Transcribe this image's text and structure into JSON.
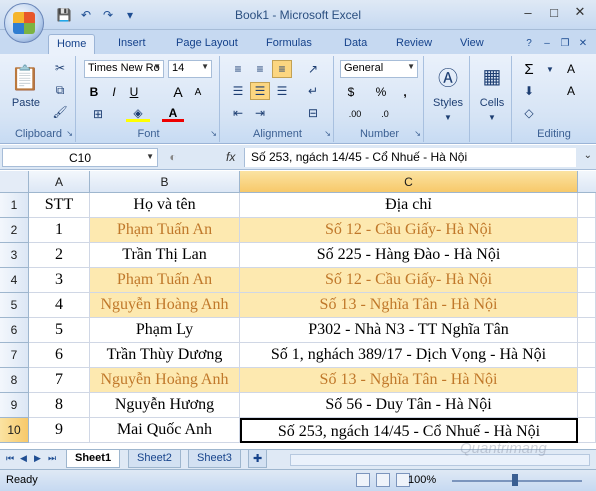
{
  "window": {
    "title": "Book1 - Microsoft Excel",
    "minimize": "–",
    "restore": "□",
    "close": "✕"
  },
  "qat": {
    "save": "💾",
    "undo": "↶",
    "redo": "↷",
    "customize": "▾"
  },
  "tabs": [
    "Home",
    "Insert",
    "Page Layout",
    "Formulas",
    "Data",
    "Review",
    "View"
  ],
  "ribbon": {
    "clipboard": {
      "label": "Clipboard",
      "paste": "Paste"
    },
    "font": {
      "label": "Font",
      "font_name": "Times New Ro",
      "font_size": "14",
      "bold": "B",
      "italic": "I",
      "underline": "U",
      "grow": "A",
      "shrink": "A"
    },
    "alignment": {
      "label": "Alignment"
    },
    "number": {
      "label": "Number",
      "format": "General",
      "currency": "$",
      "percent": "%",
      "comma": ",",
      "inc_dec": ".00",
      "dec_dec": ".0"
    },
    "styles": {
      "label": "Styles"
    },
    "cells": {
      "label": "Cells"
    },
    "editing": {
      "label": "Editing",
      "sum": "Σ",
      "sort": "A",
      "find": "A"
    }
  },
  "formula_bar": {
    "name_box": "C10",
    "fx": "fx",
    "content": "Số 253, ngách 14/45 - Cổ Nhuế - Hà Nội"
  },
  "columns": [
    "A",
    "B",
    "C"
  ],
  "rows": [
    {
      "num": "1",
      "a": "STT",
      "b": "Họ và tên",
      "c": "Địa chỉ",
      "hl": false
    },
    {
      "num": "2",
      "a": "1",
      "b": "Phạm Tuấn An",
      "c": "Số 12 - Cầu Giấy- Hà Nội",
      "hl": true
    },
    {
      "num": "3",
      "a": "2",
      "b": "Trần Thị Lan",
      "c": "Số 225 - Hàng Đào - Hà Nội",
      "hl": false
    },
    {
      "num": "4",
      "a": "3",
      "b": "Phạm Tuấn An",
      "c": "Số 12 - Cầu Giấy- Hà Nội",
      "hl": true
    },
    {
      "num": "5",
      "a": "4",
      "b": "Nguyễn Hoàng Anh",
      "c": "Số 13 - Nghĩa Tân - Hà Nội",
      "hl": true
    },
    {
      "num": "6",
      "a": "5",
      "b": "Phạm Ly",
      "c": "P302 - Nhà N3 - TT Nghĩa Tân",
      "hl": false
    },
    {
      "num": "7",
      "a": "6",
      "b": "Trần Thùy Dương",
      "c": "Số 1, nghách 389/17 - Dịch Vọng - Hà Nội",
      "hl": false
    },
    {
      "num": "8",
      "a": "7",
      "b": "Nguyễn Hoàng Anh",
      "c": "Số 13 - Nghĩa Tân - Hà Nội",
      "hl": true
    },
    {
      "num": "9",
      "a": "8",
      "b": "Nguyễn Hương",
      "c": "Số 56 - Duy Tân - Hà Nội",
      "hl": false
    },
    {
      "num": "10",
      "a": "9",
      "b": "Mai Quốc Anh",
      "c": "Số 253, ngách 14/45 - Cổ Nhuế - Hà Nội",
      "hl": false
    }
  ],
  "sheets": [
    "Sheet1",
    "Sheet2",
    "Sheet3"
  ],
  "status": {
    "ready": "Ready",
    "zoom": "100%"
  },
  "colors": {
    "highlight_fill": "#fde9b0",
    "highlight_text": "#c0782a"
  }
}
